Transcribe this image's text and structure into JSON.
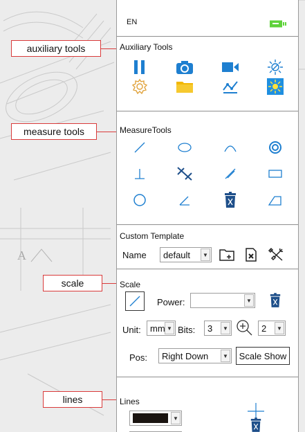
{
  "lang": "EN",
  "callouts": {
    "auxiliary": "auxiliary tools",
    "measure": "measure tools",
    "scale": "scale",
    "lines": "lines"
  },
  "auxiliary": {
    "title": "Auxiliary Tools",
    "tools": [
      "pause-icon",
      "camera-icon",
      "video-camera-icon",
      "brightness-icon",
      "settings-gear-icon",
      "folder-icon",
      "curve-icon",
      "sun-highlight-icon"
    ]
  },
  "measure": {
    "title": "MeasureTools",
    "tools": [
      "line-icon",
      "ellipse-icon",
      "arc-icon",
      "concentric-circle-icon",
      "perpendicular-icon",
      "parallel-lines-icon",
      "parallel-icon",
      "rectangle-icon",
      "circle-icon",
      "angle-icon",
      "delete-icon",
      "polygon-icon"
    ]
  },
  "template": {
    "title": "Custom Template",
    "name_label": "Name",
    "name_value": "default"
  },
  "scale": {
    "title": "Scale",
    "power_label": "Power:",
    "power_value": "",
    "unit_label": "Unit:",
    "unit_value": "mm",
    "bits_label": "Bits:",
    "bits_value": "3",
    "zoom_value": "2",
    "pos_label": "Pos:",
    "pos_value": "Right Down",
    "show_button": "Scale Show"
  },
  "lines": {
    "title": "Lines",
    "color_value": "#1a1410",
    "width_value": "1"
  },
  "colors": {
    "accent": "#1e7fd0",
    "battery": "#5fd23a",
    "callout_border": "#d93a3a"
  }
}
